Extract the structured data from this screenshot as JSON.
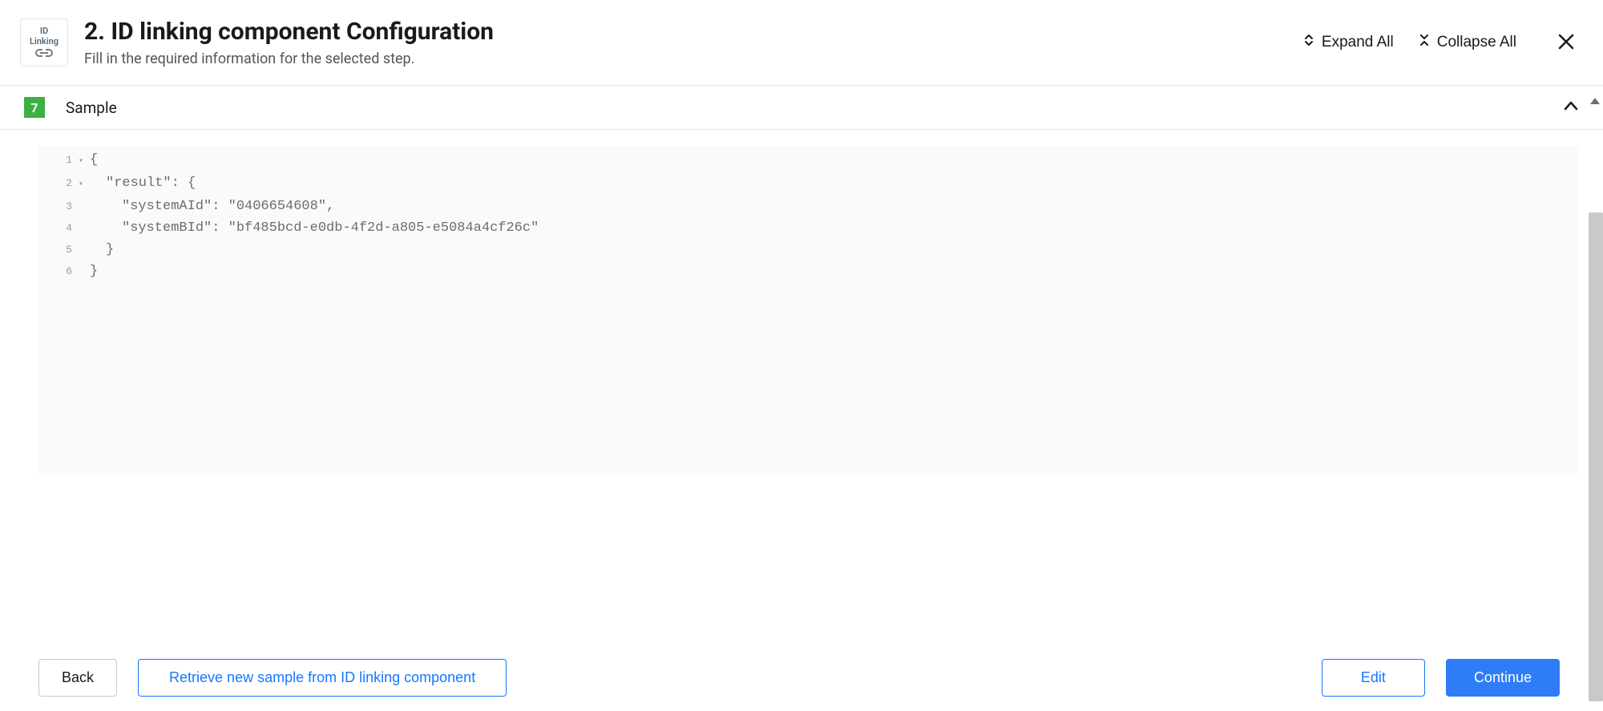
{
  "header": {
    "logo_text_line1": "ID",
    "logo_text_line2": "Linking",
    "title": "2. ID linking component Configuration",
    "subtitle": "Fill in the required information for the selected step.",
    "expand_all": "Expand All",
    "collapse_all": "Collapse All"
  },
  "section": {
    "step_number": "7",
    "title": "Sample"
  },
  "code": {
    "lines": [
      {
        "n": "1",
        "fold": "▾",
        "indent": 0,
        "text": "{"
      },
      {
        "n": "2",
        "fold": "▾",
        "indent": 1,
        "text": "\"result\": {"
      },
      {
        "n": "3",
        "fold": "",
        "indent": 2,
        "text": "\"systemAId\": \"0406654608\","
      },
      {
        "n": "4",
        "fold": "",
        "indent": 2,
        "text": "\"systemBId\": \"bf485bcd-e0db-4f2d-a805-e5084a4cf26c\""
      },
      {
        "n": "5",
        "fold": "",
        "indent": 1,
        "text": "}"
      },
      {
        "n": "6",
        "fold": "",
        "indent": 0,
        "text": "}"
      }
    ]
  },
  "footer": {
    "back": "Back",
    "retrieve": "Retrieve new sample from ID linking component",
    "edit": "Edit",
    "continue": "Continue"
  }
}
